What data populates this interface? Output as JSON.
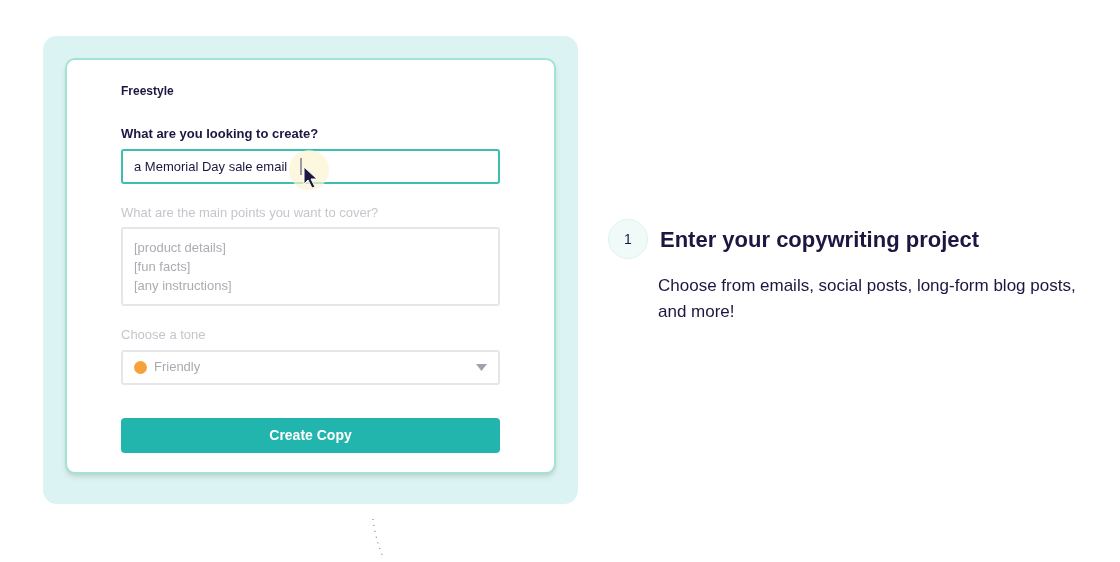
{
  "form": {
    "title": "Freestyle",
    "fields": [
      {
        "kind": "input",
        "label": "What are you looking to create?",
        "value": "a Memorial Day sale email",
        "focused": true
      },
      {
        "kind": "textarea",
        "label": "What are the main points you want to cover?",
        "placeholder": "[product details]\n[fun facts]\n[any instructions]",
        "focused": false
      },
      {
        "kind": "select",
        "label": "Choose a tone",
        "value": "Friendly",
        "focused": false
      }
    ],
    "button": "Create Copy"
  },
  "step": {
    "number": "1",
    "title": "Enter your copywriting project",
    "description": "Choose from emails, social posts, long-form blog posts, and more!"
  }
}
